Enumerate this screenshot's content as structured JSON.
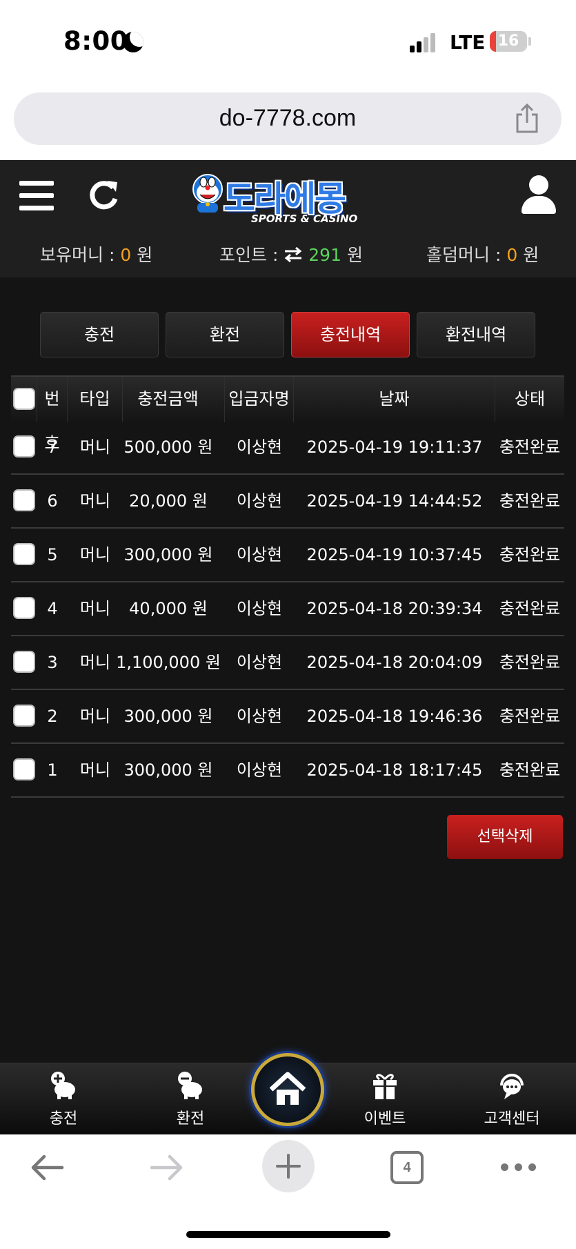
{
  "status_bar": {
    "time": "8:00",
    "network": "LTE",
    "battery": "16",
    "battery_fraction": 0.16
  },
  "browser": {
    "url": "do-7778.com",
    "tab_count": "4"
  },
  "header": {
    "logo_text": "도라에몽",
    "logo_sub": "SPORTS & CASINO",
    "balances": {
      "money_label": "보유머니 :",
      "money_value": "0",
      "money_unit": "원",
      "point_label": "포인트 :",
      "point_value": "291",
      "point_unit": "원",
      "holdem_label": "홀덤머니 :",
      "holdem_value": "0",
      "holdem_unit": "원"
    }
  },
  "tabs": [
    "충전",
    "환전",
    "충전내역",
    "환전내역"
  ],
  "active_tab": "충전내역",
  "table": {
    "headers": [
      "번호",
      "타입",
      "충전금액",
      "입금자명",
      "날짜",
      "상태"
    ],
    "rows": [
      {
        "no": "7",
        "type": "머니",
        "amount": "500,000 원",
        "name": "이상현",
        "date": "2025-04-19 19:11:37",
        "status": "충전완료"
      },
      {
        "no": "6",
        "type": "머니",
        "amount": "20,000 원",
        "name": "이상현",
        "date": "2025-04-19 14:44:52",
        "status": "충전완료"
      },
      {
        "no": "5",
        "type": "머니",
        "amount": "300,000 원",
        "name": "이상현",
        "date": "2025-04-19 10:37:45",
        "status": "충전완료"
      },
      {
        "no": "4",
        "type": "머니",
        "amount": "40,000 원",
        "name": "이상현",
        "date": "2025-04-18 20:39:34",
        "status": "충전완료"
      },
      {
        "no": "3",
        "type": "머니",
        "amount": "1,100,000 원",
        "name": "이상현",
        "date": "2025-04-18 20:04:09",
        "status": "충전완료"
      },
      {
        "no": "2",
        "type": "머니",
        "amount": "300,000 원",
        "name": "이상현",
        "date": "2025-04-18 19:46:36",
        "status": "충전완료"
      },
      {
        "no": "1",
        "type": "머니",
        "amount": "300,000 원",
        "name": "이상현",
        "date": "2025-04-18 18:17:45",
        "status": "충전완료"
      }
    ]
  },
  "delete_button": "선택삭제",
  "bottom_nav": {
    "charge": "충전",
    "exchange": "환전",
    "event": "이벤트",
    "support": "고객센터"
  },
  "colors": {
    "accent_red": "#c8201f",
    "money_orange": "#f4a21f",
    "point_green": "#5bd35b",
    "background": "#141414"
  }
}
